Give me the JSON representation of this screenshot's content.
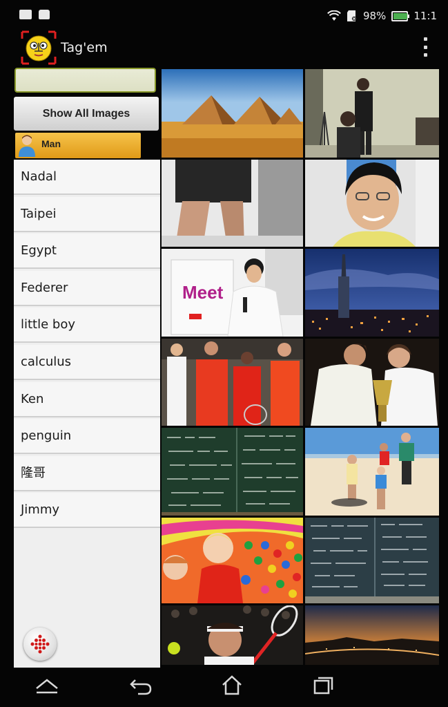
{
  "status_bar": {
    "battery_text": "98%",
    "battery_level": 0.98,
    "time": "11:1",
    "icons": [
      "image-notification-icon",
      "bag-notification-icon",
      "wifi-icon",
      "sd-card-icon",
      "battery-icon"
    ]
  },
  "action_bar": {
    "title": "Tag'em",
    "icon": "tagem-face-icon",
    "menu_icon": "overflow-menu-icon"
  },
  "panel": {
    "search_value": "",
    "show_all_label": "Show All Images",
    "active_tag": "Man",
    "tags": [
      "Nadal",
      "Taipei",
      "Egypt",
      "Federer",
      "little boy",
      "calculus",
      "Ken",
      "penguin",
      "隆哥",
      "Jimmy"
    ],
    "fab_icon": "grid-dots-icon"
  },
  "gallery": {
    "images": [
      "egypt-pyramids-photo",
      "room-with-tripod-photo",
      "legs-closeup-photo",
      "smiling-boy-glasses-photo",
      "boy-presenting-meet-poster-photo",
      "taipei-101-night-photo",
      "tennis-players-group-photo",
      "tennis-trophy-photo",
      "chalkboard-equations-photo",
      "family-beach-photo",
      "children-ball-pit-photo",
      "blackboard-math-photo",
      "tennis-player-racket-photo",
      "city-bridge-dusk-photo"
    ]
  },
  "nav_bar": {
    "buttons": [
      "home-icon",
      "back-icon",
      "home-house-icon",
      "recent-apps-icon"
    ]
  },
  "colors": {
    "chip_orange": "#f0b030",
    "search_border": "#8a9a2a",
    "background": "#050505"
  }
}
